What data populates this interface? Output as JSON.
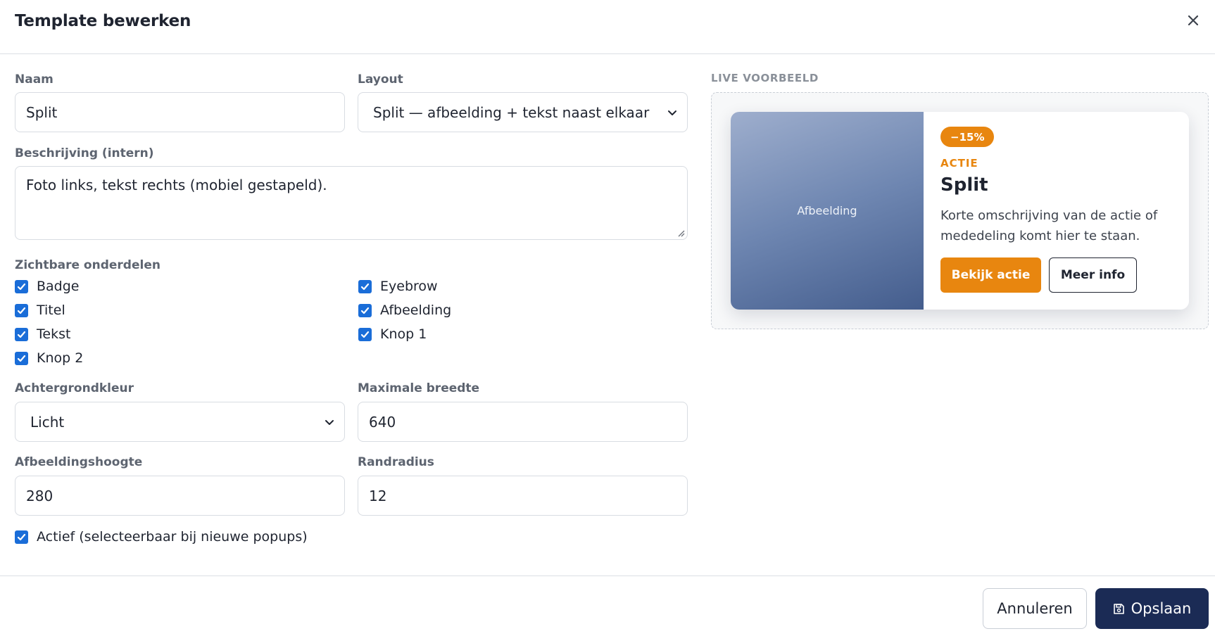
{
  "dialog": {
    "title": "Template bewerken"
  },
  "form": {
    "name": {
      "label": "Naam",
      "value": "Split"
    },
    "layout": {
      "label": "Layout",
      "value": "Split — afbeelding + tekst naast elkaar"
    },
    "description": {
      "label": "Beschrijving (intern)",
      "value": "Foto links, tekst rechts (mobiel gestapeld)."
    },
    "visible_parts": {
      "label": "Zichtbare onderdelen",
      "items": [
        {
          "label": "Badge",
          "checked": true
        },
        {
          "label": "Eyebrow",
          "checked": true
        },
        {
          "label": "Titel",
          "checked": true
        },
        {
          "label": "Afbeelding",
          "checked": true
        },
        {
          "label": "Tekst",
          "checked": true
        },
        {
          "label": "Knop 1",
          "checked": true
        },
        {
          "label": "Knop 2",
          "checked": true
        }
      ]
    },
    "background": {
      "label": "Achtergrondkleur",
      "value": "Licht"
    },
    "max_width": {
      "label": "Maximale breedte",
      "value": "640"
    },
    "image_height": {
      "label": "Afbeeldingshoogte",
      "value": "280"
    },
    "border_radius": {
      "label": "Randradius",
      "value": "12"
    },
    "active": {
      "label": "Actief (selecteerbaar bij nieuwe popups)",
      "checked": true
    }
  },
  "preview": {
    "label": "LIVE VOORBEELD",
    "image_placeholder": "Afbeelding",
    "badge": "−15%",
    "eyebrow": "ACTIE",
    "title": "Split",
    "text": "Korte omschrijving van de actie of mededeling komt hier te staan.",
    "primary_button": "Bekijk actie",
    "secondary_button": "Meer info"
  },
  "footer": {
    "cancel": "Annuleren",
    "save": "Opslaan"
  },
  "colors": {
    "accent": "#e8860f",
    "primary": "#1b2b55",
    "checkbox": "#1a6dd8"
  },
  "icons": {
    "close": "close-icon",
    "chevron": "chevron-down-icon",
    "save": "floppy-disk-icon",
    "check": "check-icon"
  }
}
